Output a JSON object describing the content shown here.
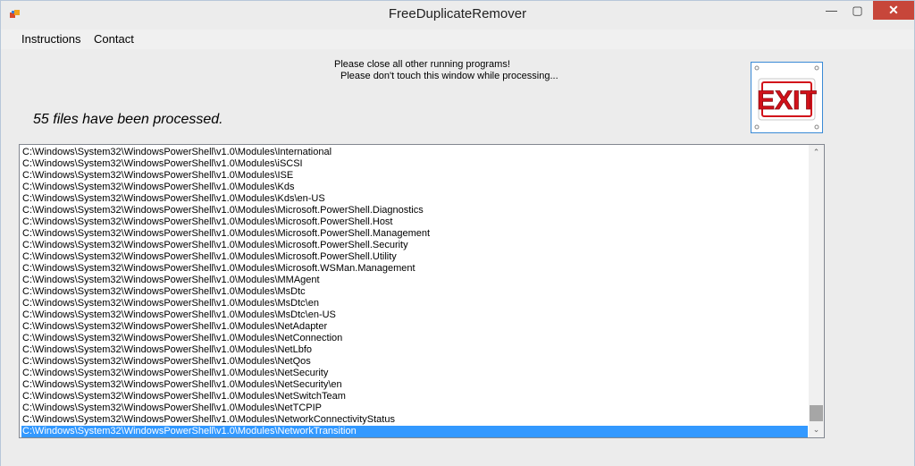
{
  "window": {
    "title": "FreeDuplicateRemover",
    "controls": {
      "minimize": "—",
      "maximize": "▢",
      "close": "✕"
    }
  },
  "menu": {
    "items": [
      "Instructions",
      "Contact"
    ]
  },
  "notice": {
    "line1": "Please close all other running programs!",
    "line2": "Please don't touch this window while processing..."
  },
  "status": {
    "processed": "55 files have been processed."
  },
  "exit_button": {
    "label": "EXIT",
    "color": "#d2111a"
  },
  "list": {
    "items": [
      "C:\\Windows\\System32\\WindowsPowerShell\\v1.0\\Modules\\International",
      "C:\\Windows\\System32\\WindowsPowerShell\\v1.0\\Modules\\iSCSI",
      "C:\\Windows\\System32\\WindowsPowerShell\\v1.0\\Modules\\ISE",
      "C:\\Windows\\System32\\WindowsPowerShell\\v1.0\\Modules\\Kds",
      "C:\\Windows\\System32\\WindowsPowerShell\\v1.0\\Modules\\Kds\\en-US",
      "C:\\Windows\\System32\\WindowsPowerShell\\v1.0\\Modules\\Microsoft.PowerShell.Diagnostics",
      "C:\\Windows\\System32\\WindowsPowerShell\\v1.0\\Modules\\Microsoft.PowerShell.Host",
      "C:\\Windows\\System32\\WindowsPowerShell\\v1.0\\Modules\\Microsoft.PowerShell.Management",
      "C:\\Windows\\System32\\WindowsPowerShell\\v1.0\\Modules\\Microsoft.PowerShell.Security",
      "C:\\Windows\\System32\\WindowsPowerShell\\v1.0\\Modules\\Microsoft.PowerShell.Utility",
      "C:\\Windows\\System32\\WindowsPowerShell\\v1.0\\Modules\\Microsoft.WSMan.Management",
      "C:\\Windows\\System32\\WindowsPowerShell\\v1.0\\Modules\\MMAgent",
      "C:\\Windows\\System32\\WindowsPowerShell\\v1.0\\Modules\\MsDtc",
      "C:\\Windows\\System32\\WindowsPowerShell\\v1.0\\Modules\\MsDtc\\en",
      "C:\\Windows\\System32\\WindowsPowerShell\\v1.0\\Modules\\MsDtc\\en-US",
      "C:\\Windows\\System32\\WindowsPowerShell\\v1.0\\Modules\\NetAdapter",
      "C:\\Windows\\System32\\WindowsPowerShell\\v1.0\\Modules\\NetConnection",
      "C:\\Windows\\System32\\WindowsPowerShell\\v1.0\\Modules\\NetLbfo",
      "C:\\Windows\\System32\\WindowsPowerShell\\v1.0\\Modules\\NetQos",
      "C:\\Windows\\System32\\WindowsPowerShell\\v1.0\\Modules\\NetSecurity",
      "C:\\Windows\\System32\\WindowsPowerShell\\v1.0\\Modules\\NetSecurity\\en",
      "C:\\Windows\\System32\\WindowsPowerShell\\v1.0\\Modules\\NetSwitchTeam",
      "C:\\Windows\\System32\\WindowsPowerShell\\v1.0\\Modules\\NetTCPIP",
      "C:\\Windows\\System32\\WindowsPowerShell\\v1.0\\Modules\\NetworkConnectivityStatus",
      "C:\\Windows\\System32\\WindowsPowerShell\\v1.0\\Modules\\NetworkTransition"
    ],
    "selected_index": 24
  },
  "scrollbar": {
    "up": "⌃",
    "down": "⌄",
    "position": 0.94
  }
}
